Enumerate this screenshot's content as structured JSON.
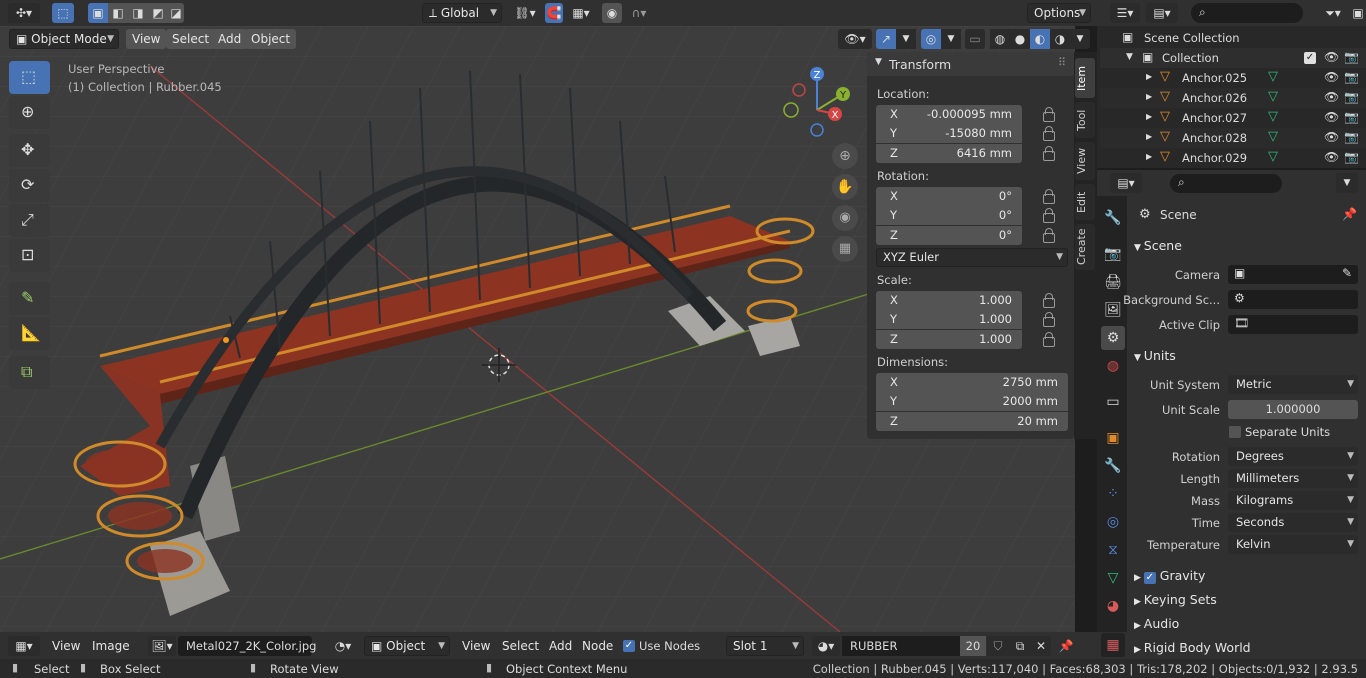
{
  "viewport_header": {
    "transform_orientation": "Global",
    "options_label": "Options"
  },
  "viewport_toolbar": {
    "mode": "Object Mode",
    "menus": [
      "View",
      "Select",
      "Add",
      "Object"
    ]
  },
  "overlay": {
    "perspective": "User Perspective",
    "collection_info": "(1) Collection | Rubber.045"
  },
  "sidebar_tabs": [
    "Item",
    "Tool",
    "View",
    "Edit",
    "Create"
  ],
  "transform": {
    "title": "Transform",
    "location_label": "Location:",
    "location": [
      {
        "axis": "X",
        "value": "-0.000095 mm"
      },
      {
        "axis": "Y",
        "value": "-15080 mm"
      },
      {
        "axis": "Z",
        "value": "6416 mm"
      }
    ],
    "rotation_label": "Rotation:",
    "rotation": [
      {
        "axis": "X",
        "value": "0°"
      },
      {
        "axis": "Y",
        "value": "0°"
      },
      {
        "axis": "Z",
        "value": "0°"
      }
    ],
    "rotation_mode": "XYZ Euler",
    "scale_label": "Scale:",
    "scale": [
      {
        "axis": "X",
        "value": "1.000"
      },
      {
        "axis": "Y",
        "value": "1.000"
      },
      {
        "axis": "Z",
        "value": "1.000"
      }
    ],
    "dimensions_label": "Dimensions:",
    "dimensions": [
      {
        "axis": "X",
        "value": "2750 mm"
      },
      {
        "axis": "Y",
        "value": "2000 mm"
      },
      {
        "axis": "Z",
        "value": "20 mm"
      }
    ]
  },
  "outliner": {
    "scene_collection": "Scene Collection",
    "collection": "Collection",
    "items": [
      "Anchor.025",
      "Anchor.026",
      "Anchor.027",
      "Anchor.028",
      "Anchor.029"
    ]
  },
  "properties": {
    "header": "Scene",
    "scene_panel": "Scene",
    "camera_label": "Camera",
    "background_label": "Background Sc...",
    "active_clip_label": "Active Clip",
    "units_panel": "Units",
    "unit_system_label": "Unit System",
    "unit_system": "Metric",
    "unit_scale_label": "Unit Scale",
    "unit_scale": "1.000000",
    "separate_units": "Separate Units",
    "rotation_label": "Rotation",
    "rotation": "Degrees",
    "length_label": "Length",
    "length": "Millimeters",
    "mass_label": "Mass",
    "mass": "Kilograms",
    "time_label": "Time",
    "time": "Seconds",
    "temperature_label": "Temperature",
    "temperature": "Kelvin",
    "gravity": "Gravity",
    "keying_sets": "Keying Sets",
    "audio": "Audio",
    "rigid_body": "Rigid Body World"
  },
  "bottom_header": {
    "view": "View",
    "image": "Image",
    "image_name": "Metal027_2K_Color.jpg",
    "object_mode": "Object",
    "view2": "View",
    "select": "Select",
    "add": "Add",
    "node": "Node",
    "use_nodes": "Use Nodes",
    "slot": "Slot 1",
    "material": "RUBBER",
    "users": "20"
  },
  "statusbar": {
    "select": "Select",
    "box_select": "Box Select",
    "rotate_view": "Rotate View",
    "context_menu": "Object Context Menu",
    "stats": "Collection | Rubber.045 | Verts:117,040 | Faces:68,303 | Tris:178,202 | Objects:0/1,932 | 2.93.5"
  },
  "colors": {
    "accent": "#4772b3",
    "x_axis": "#a23a3a",
    "y_axis": "#6a8c2a",
    "bridge_steel": "#2a2d2e",
    "deck": "#8c3322",
    "railing": "#d08a2a"
  }
}
